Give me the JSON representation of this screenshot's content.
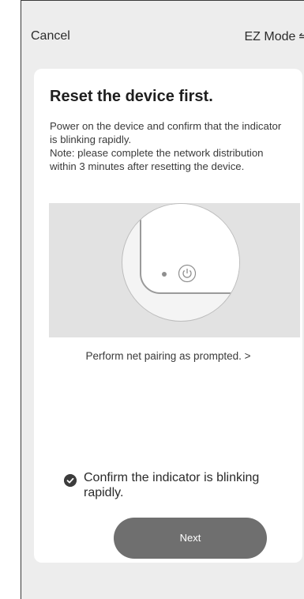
{
  "topbar": {
    "cancel_label": "Cancel",
    "mode_label": "EZ Mode",
    "mode_icon": "⇋"
  },
  "card": {
    "title": "Reset the device first.",
    "description_lines": [
      "Power on the device and confirm that the indicator is blinking rapidly.",
      "Note: please complete the network distribution within 3 minutes after resetting the device."
    ],
    "pairing_link": "Perform net pairing as prompted. >",
    "confirm_text": "Confirm the indicator is blinking rapidly.",
    "confirm_checked": true,
    "next_label": "Next"
  },
  "icons": {
    "swap": "swap-arrows-icon",
    "power": "power-icon",
    "check": "check-circle-icon"
  },
  "colors": {
    "button": "#6f6f6f",
    "background": "#ededed",
    "card": "#ffffff"
  }
}
